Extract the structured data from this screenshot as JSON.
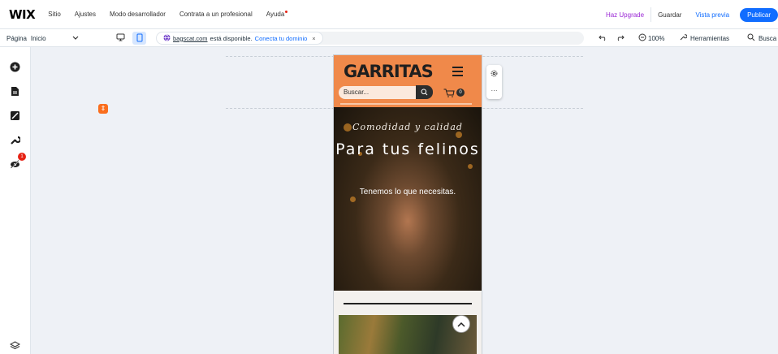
{
  "app": {
    "logo": "WIX",
    "menu": [
      "Sitio",
      "Ajustes",
      "Modo desarrollador",
      "Contrata a un profesional",
      "Ayuda"
    ],
    "upgrade_label": "Haz Upgrade",
    "save_label": "Guardar",
    "preview_label": "Vista previa",
    "publish_label": "Publicar"
  },
  "toolbar": {
    "page_label": "Página",
    "page_value": "Inicio",
    "domain": "bagscat.com",
    "domain_msg": "está disponible.",
    "domain_link": "Conecta tu dominio",
    "close": "×",
    "zoom": "100%",
    "tools_label": "Herramientas",
    "search_label": "Busca"
  },
  "sidebar": {
    "notification_count": "1"
  },
  "site": {
    "brand": "GARRITAS",
    "search_placeholder": "Buscar...",
    "cart_count": "0",
    "hero_subtitle": "Comodidad y calidad",
    "hero_title": "Para tus felinos",
    "hero_text": "Tenemos lo que necesitas."
  },
  "colors": {
    "accent": "#116dff",
    "upgrade": "#9a27d5",
    "header_orange": "#f0894a"
  }
}
